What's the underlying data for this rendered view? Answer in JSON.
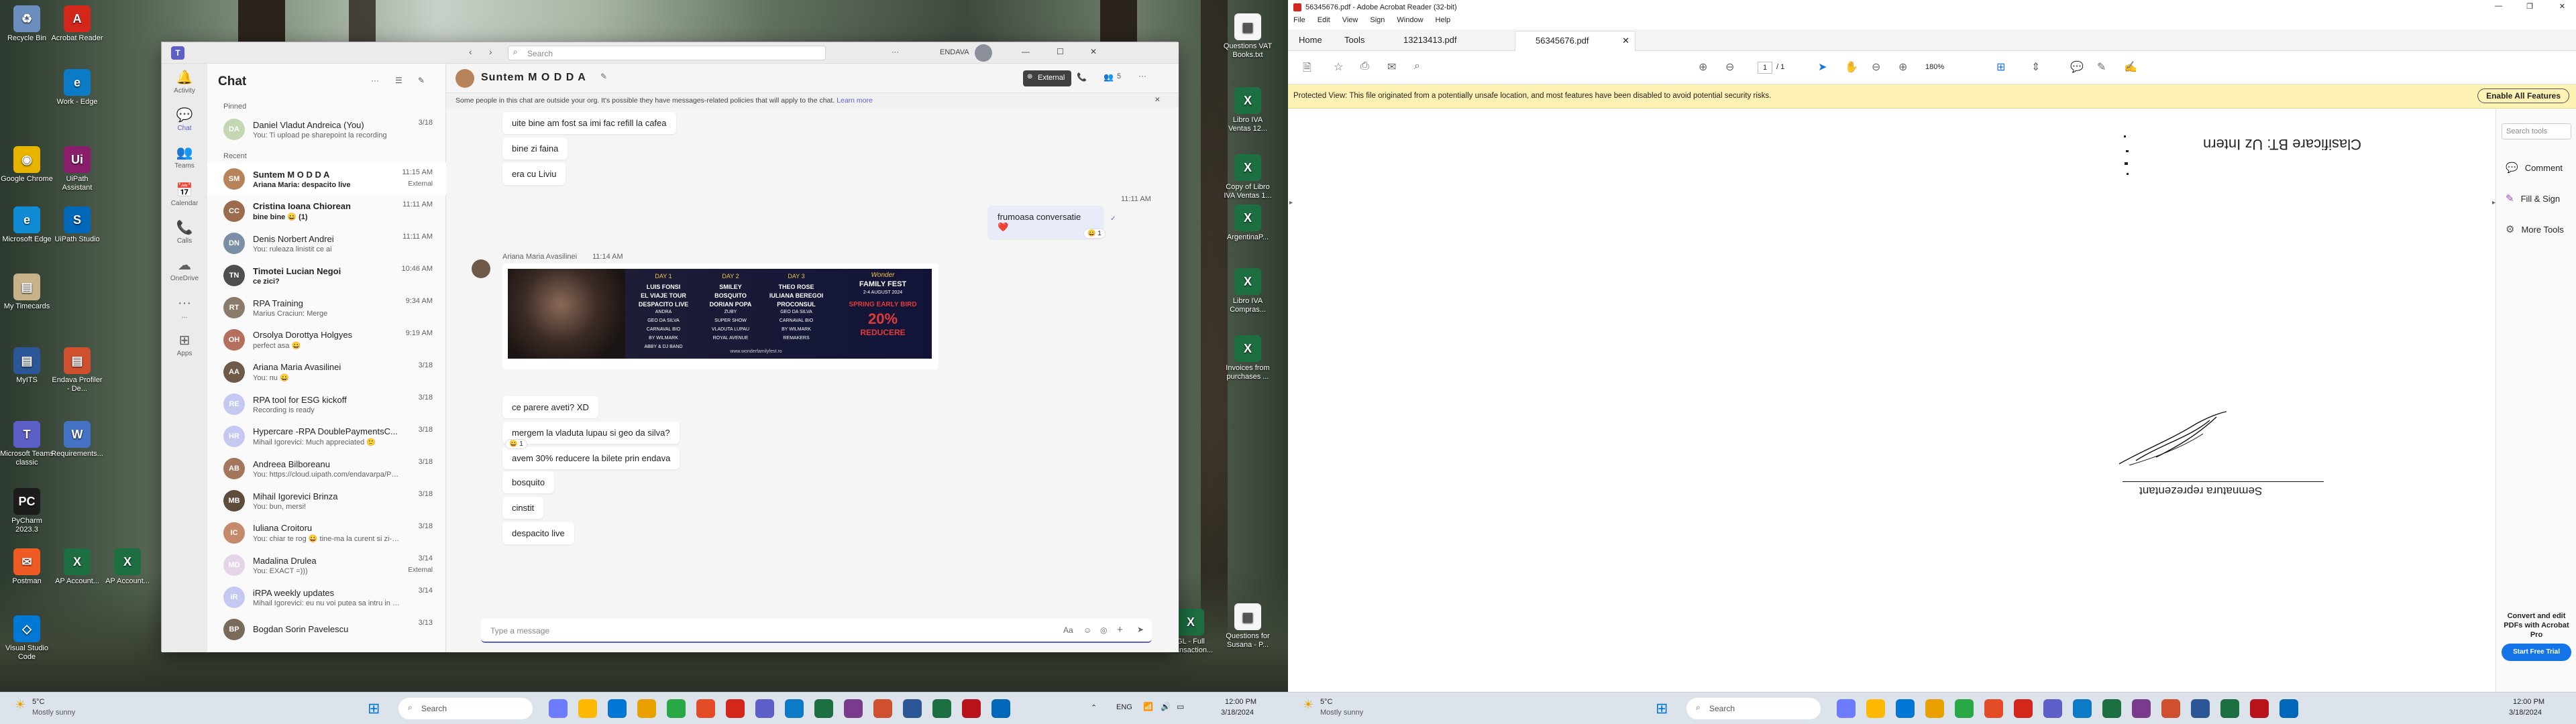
{
  "desktop_left": {
    "icons": [
      {
        "label": "Recycle Bin",
        "color": "#6c8ebf",
        "glyph": "♻"
      },
      {
        "label": "Acrobat Reader",
        "color": "#d4271c",
        "glyph": "A"
      },
      {
        "label": "Google Chrome",
        "color": "#e8b400",
        "glyph": "◉"
      },
      {
        "label": "Work - Edge",
        "color": "#0b7bc8",
        "glyph": "e"
      },
      {
        "label": "Microsoft Edge",
        "color": "#108bd4",
        "glyph": "e"
      },
      {
        "label": "UiPath Assistant",
        "color": "#8b1e6c",
        "glyph": "Ui"
      },
      {
        "label": "My Timecards",
        "color": "#c7b28a",
        "glyph": "▤"
      },
      {
        "label": "UiPath Studio",
        "color": "#0067b9",
        "glyph": "S"
      },
      {
        "label": "MyITS",
        "color": "#2b5797",
        "glyph": "▤"
      },
      {
        "label": "Endava Profiler - De...",
        "color": "#d04f2f",
        "glyph": "▤"
      },
      {
        "label": "Microsoft Teams classic",
        "color": "#5b5fc7",
        "glyph": "T"
      },
      {
        "label": "Requirements...",
        "color": "#4472c4",
        "glyph": "W"
      },
      {
        "label": "PyCharm 2023.3",
        "color": "#1c1c1c",
        "glyph": "PC"
      },
      {
        "label": "Postman",
        "color": "#ef5b25",
        "glyph": "✉"
      },
      {
        "label": "AP Account...",
        "color": "#1d6f42",
        "glyph": "X"
      },
      {
        "label": "AP Account...",
        "color": "#1d6f42",
        "glyph": "X"
      },
      {
        "label": "Visual Studio Code",
        "color": "#0078d4",
        "glyph": "◇"
      },
      {
        "label": "GL - Full Transaction...",
        "color": "#1d6f42",
        "glyph": "X"
      }
    ],
    "right_icons": [
      {
        "label": "Questions VAT Books.txt",
        "color": "#f5f5f5",
        "glyph": "▤"
      },
      {
        "label": "Libro IVA Ventas 12...",
        "color": "#1d6f42",
        "glyph": "X"
      },
      {
        "label": "Copy of Libro IVA Ventas 1...",
        "color": "#1d6f42",
        "glyph": "X"
      },
      {
        "label": "ArgentinaP...",
        "color": "#1d6f42",
        "glyph": "X"
      },
      {
        "label": "Libro IVA Compras...",
        "color": "#1d6f42",
        "glyph": "X"
      },
      {
        "label": "Invoices from purchases ...",
        "color": "#1d6f42",
        "glyph": "X"
      },
      {
        "label": "Questions for Susana - P...",
        "color": "#f5f5f5",
        "glyph": "▤"
      }
    ]
  },
  "teams": {
    "search_placeholder": "Search",
    "org": "ENDAVA",
    "rail": [
      {
        "label": "Activity",
        "icon": "bell-icon",
        "glyph": "🔔"
      },
      {
        "label": "Chat",
        "icon": "chat-icon",
        "glyph": "💬"
      },
      {
        "label": "Teams",
        "icon": "teams-icon",
        "glyph": "👥"
      },
      {
        "label": "Calendar",
        "icon": "calendar-icon",
        "glyph": "📅"
      },
      {
        "label": "Calls",
        "icon": "phone-icon",
        "glyph": "📞"
      },
      {
        "label": "OneDrive",
        "icon": "cloud-icon",
        "glyph": "☁"
      },
      {
        "label": "...",
        "icon": "more-icon",
        "glyph": "···"
      },
      {
        "label": "Apps",
        "icon": "apps-icon",
        "glyph": "⊞"
      }
    ],
    "chat_title": "Chat",
    "pinned_label": "Pinned",
    "recent_label": "Recent",
    "pinned": [
      {
        "name": "Daniel Vladut Andreica (You)",
        "preview": "You: Ti upload pe sharepoint la recording",
        "time": "3/18",
        "initials": "DA",
        "color": "#c4d7b2"
      }
    ],
    "recent": [
      {
        "name": "Suntem M O D D A",
        "preview": "Ariana Maria: despacito live",
        "time": "11:15 AM",
        "badge": "External",
        "initials": "SM",
        "color": "#b7835a",
        "bold": true,
        "selected": true
      },
      {
        "name": "Cristina Ioana Chiorean",
        "preview": "bine bine 😀 (1)",
        "time": "11:11 AM",
        "initials": "CC",
        "color": "#9c6b4e",
        "bold": true
      },
      {
        "name": "Denis Norbert Andrei",
        "preview": "You: ruleaza linistit ce ai",
        "time": "11:11 AM",
        "initials": "DN",
        "color": "#7a8fa3"
      },
      {
        "name": "Timotei Lucian Negoi",
        "preview": "ce zici?",
        "time": "10:46 AM",
        "initials": "TN",
        "color": "#4e4e4e",
        "bold": true
      },
      {
        "name": "RPA Training",
        "preview": "Marius Craciun: Merge",
        "time": "9:34 AM",
        "initials": "RT",
        "color": "#8a7b6a"
      },
      {
        "name": "Orsolya Dorottya Holgyes",
        "preview": "perfect asa 😀",
        "time": "9:19 AM",
        "initials": "OH",
        "color": "#b56f5f"
      },
      {
        "name": "Ariana Maria Avasilinei",
        "preview": "You: nu 😀",
        "time": "3/18",
        "initials": "AA",
        "color": "#6f5a4a"
      },
      {
        "name": "RPA tool for ESG kickoff",
        "preview": "Recording is ready",
        "time": "3/18",
        "initials": "RE",
        "color": "#c5c8f0"
      },
      {
        "name": "Hypercare -RPA DoublePaymentsC...",
        "preview": "Mihail Igorevici: Much appreciated 🙂",
        "time": "3/18",
        "initials": "HR",
        "color": "#c5c8f0"
      },
      {
        "name": "Andreea Bilboreanu",
        "preview": "You: https://cloud.uipath.com/endavarpa/PRD/...",
        "time": "3/18",
        "initials": "AB",
        "color": "#a4765c"
      },
      {
        "name": "Mihail Igorevici Brinza",
        "preview": "You: bun, mersi!",
        "time": "3/18",
        "initials": "MB",
        "color": "#5c4c3c"
      },
      {
        "name": "Iuliana Croitoru",
        "preview": "You: chiar te rog 😀 tine-ma la curent si zi-mi ...",
        "time": "3/18",
        "initials": "IC",
        "color": "#c48a6a"
      },
      {
        "name": "Madalina Drulea",
        "preview": "You: EXACT =)))",
        "time": "3/14",
        "badge": "External",
        "initials": "MD",
        "color": "#e3d4e8"
      },
      {
        "name": "iRPA weekly updates",
        "preview": "Mihail Igorevici: eu nu voi putea sa intru in tim...",
        "time": "3/14",
        "initials": "iR",
        "color": "#c5c8f0"
      },
      {
        "name": "Bogdan Sorin Pavelescu",
        "preview": "",
        "time": "3/13",
        "initials": "BP",
        "color": "#7a6a5a"
      }
    ],
    "convo_title": "Suntem M O D D A",
    "external_label": "External",
    "people_count": "5",
    "banner": "Some people in this chat are outside your org. It's possible they have messages-related policies that will apply to the chat.",
    "banner_link": "Learn more",
    "messages_top": [
      "uite bine am fost sa imi fac refill la cafea",
      "bine zi faina",
      "era cu Liviu"
    ],
    "my_time": "11:11 AM",
    "my_msg": "frumoasa conversatie ❤️",
    "my_reaction": "😀 1",
    "sender": "Ariana Maria Avasilinei",
    "sender_time": "11:14 AM",
    "poster": {
      "day1": "DAY 1",
      "day2": "DAY 2",
      "day3": "DAY 3",
      "d1_lines": [
        "LUIS FONSI",
        "EL VIAJE TOUR",
        "DESPACITO LIVE",
        "ANDRA",
        "GEO DA SILVA",
        "CARNAVAL BIO",
        "BY WILMARK",
        "ABBY & DJ BAND"
      ],
      "d2_lines": [
        "SMILEY",
        "BOSQUITO",
        "DORIAN POPA",
        "ZUBY",
        "SUPER SHOW",
        "VLADUTA LUPAU",
        "ROYAL AVENUE"
      ],
      "d3_lines": [
        "THEO ROSE",
        "IULIANA BEREGOI",
        "PROCONSUL",
        "GEO DA SILVA",
        "CARNAVAL BIO",
        "BY WILMARK",
        "REMAKERS"
      ],
      "brand_top": "Wonder",
      "brand": "FAMILY FEST",
      "dates": "2-4 AUGUST 2024",
      "offer_line1": "SPRING EARLY BIRD",
      "offer_pct": "20%",
      "offer_word": "REDUCERE",
      "url": "www.wonderfamilyfest.ro"
    },
    "messages_bottom": [
      "ce parere aveti? XD",
      "mergem la vladuta lupau si geo da silva?",
      "avem 30% reducere la bilete prin endava",
      "bosquito",
      "cinstit",
      "despacito live"
    ],
    "reaction2": "😀 1",
    "compose_placeholder": "Type a message"
  },
  "acrobat": {
    "title": "56345676.pdf - Adobe Acrobat Reader (32-bit)",
    "menu": [
      "File",
      "Edit",
      "View",
      "Sign",
      "Window",
      "Help"
    ],
    "tabs": [
      "Home",
      "Tools",
      "13213413.pdf",
      "56345676.pdf"
    ],
    "page_num": "1",
    "page_total": "/ 1",
    "zoom": "180%",
    "protected": "Protected View: This file originated from a potentially unsafe location, and most features have been disabled to avoid potential security risks.",
    "enable_btn": "Enable All Features",
    "doc_text1": "Clasificare BT: Uz Intern",
    "doc_text2": "Semnatura reprezentant",
    "search_tools": "Search tools",
    "tools": [
      {
        "label": "Comment",
        "icon": "comment-icon",
        "color": "#e9b200"
      },
      {
        "label": "Fill & Sign",
        "icon": "pen-icon",
        "color": "#9b46c9"
      },
      {
        "label": "More Tools",
        "icon": "tools-icon",
        "color": "#555"
      }
    ],
    "promo_title": "Convert and edit PDFs with Acrobat Pro",
    "promo_btn": "Start Free Trial"
  },
  "taskbar": {
    "weather_temp": "5°C",
    "weather_desc": "Mostly sunny",
    "search": "Search",
    "lang": "ENG",
    "time": "12:00 PM",
    "date": "3/18/2024"
  }
}
